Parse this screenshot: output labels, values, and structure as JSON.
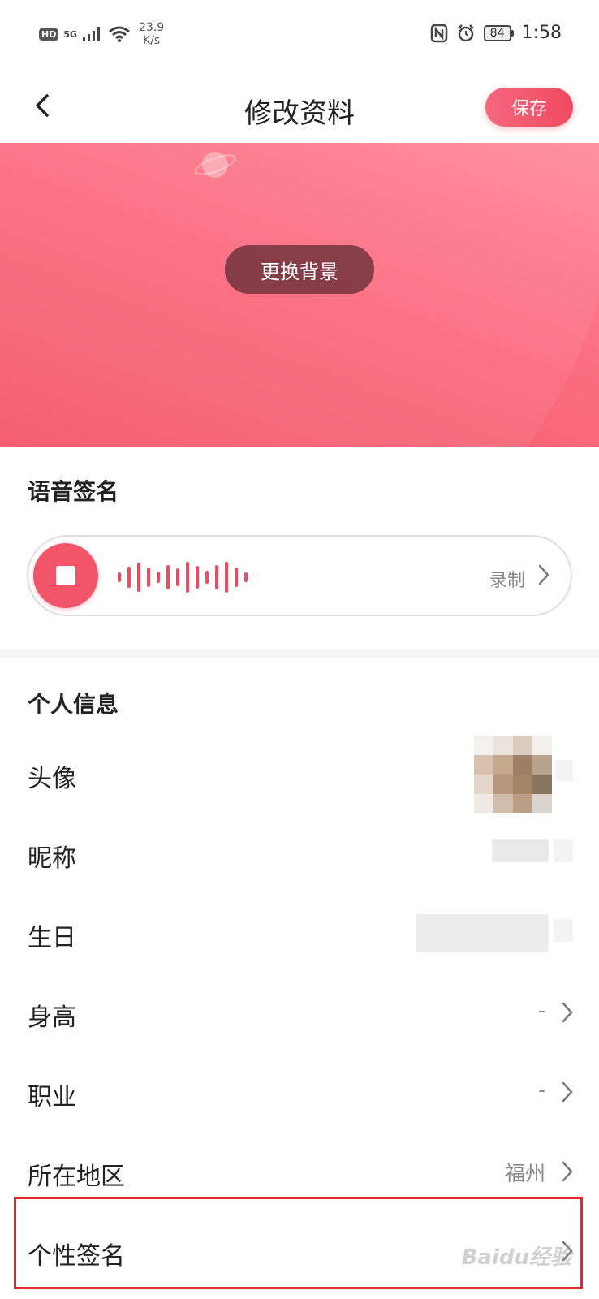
{
  "status_bar": {
    "hd": "HD",
    "network": "5G",
    "speed_value": "23.9",
    "speed_unit": "K/s",
    "battery": "84",
    "time": "1:58"
  },
  "header": {
    "title": "修改资料",
    "save_label": "保存"
  },
  "banner": {
    "change_background_label": "更换背景"
  },
  "voice_signature": {
    "title": "语音签名",
    "record_label": "录制"
  },
  "personal_info": {
    "title": "个人信息",
    "rows": [
      {
        "label": "头像",
        "value": ""
      },
      {
        "label": "昵称",
        "value": ""
      },
      {
        "label": "生日",
        "value": ""
      },
      {
        "label": "身高",
        "value": "-"
      },
      {
        "label": "职业",
        "value": "-"
      },
      {
        "label": "所在地区",
        "value": "福州"
      },
      {
        "label": "个性签名",
        "value": ""
      }
    ]
  },
  "watermark": "Baidu经验",
  "colors": {
    "accent": "#f04a62",
    "banner": "#fb6d80",
    "highlight": "#e8262a"
  }
}
